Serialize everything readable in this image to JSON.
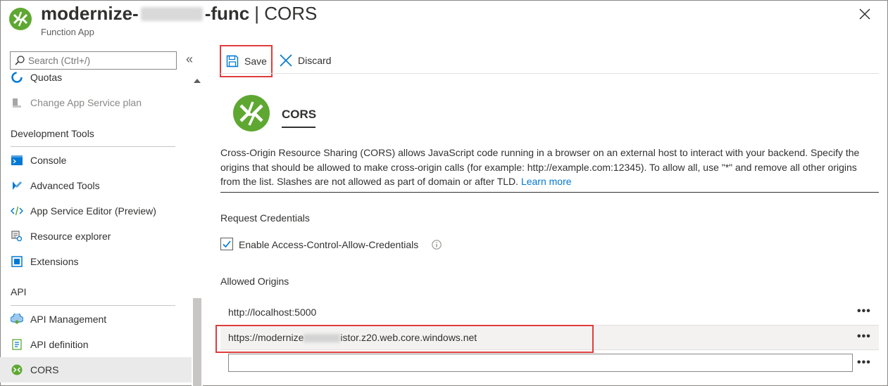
{
  "header": {
    "title_prefix": "modernize-",
    "title_suffix": "-func",
    "title_page": "| CORS",
    "subtitle": "Function App"
  },
  "sidebar": {
    "search_placeholder": "Search (Ctrl+/)",
    "collapse_label": "«",
    "items_top": [
      {
        "label": "Quotas",
        "icon": "quotas-icon"
      },
      {
        "label": "Change App Service plan",
        "icon": "change-plan-icon",
        "disabled": true
      }
    ],
    "groups": [
      {
        "label": "Development Tools",
        "items": [
          {
            "label": "Console",
            "icon": "console-icon"
          },
          {
            "label": "Advanced Tools",
            "icon": "advanced-tools-icon"
          },
          {
            "label": "App Service Editor (Preview)",
            "icon": "code-editor-icon"
          },
          {
            "label": "Resource explorer",
            "icon": "resource-explorer-icon"
          },
          {
            "label": "Extensions",
            "icon": "extensions-icon"
          }
        ]
      },
      {
        "label": "API",
        "items": [
          {
            "label": "API Management",
            "icon": "api-management-icon"
          },
          {
            "label": "API definition",
            "icon": "api-definition-icon"
          },
          {
            "label": "CORS",
            "icon": "cors-icon",
            "active": true
          }
        ]
      }
    ]
  },
  "toolbar": {
    "save_label": "Save",
    "discard_label": "Discard"
  },
  "main": {
    "title": "CORS",
    "description": "Cross-Origin Resource Sharing (CORS) allows JavaScript code running in a browser on an external host to interact with your backend. Specify the origins that should be allowed to make cross-origin calls (for example: http://example.com:12345). To allow all, use \"*\" and remove all other origins from the list. Slashes are not allowed as part of domain or after TLD.",
    "learn_more": "Learn more",
    "request_credentials_label": "Request Credentials",
    "credentials_checkbox_label": "Enable Access-Control-Allow-Credentials",
    "credentials_checked": true,
    "allowed_origins_label": "Allowed Origins",
    "origins": [
      {
        "value": "http://localhost:5000"
      },
      {
        "prefix": "https://modernize",
        "suffix": "istor.z20.web.core.windows.net"
      }
    ],
    "new_origin_value": "",
    "more_label": "•••"
  },
  "colors": {
    "azure_green": "#59b4d9",
    "function_green": "#5ea832",
    "link_blue": "#0078d4",
    "highlight_red": "#e03c3c"
  }
}
